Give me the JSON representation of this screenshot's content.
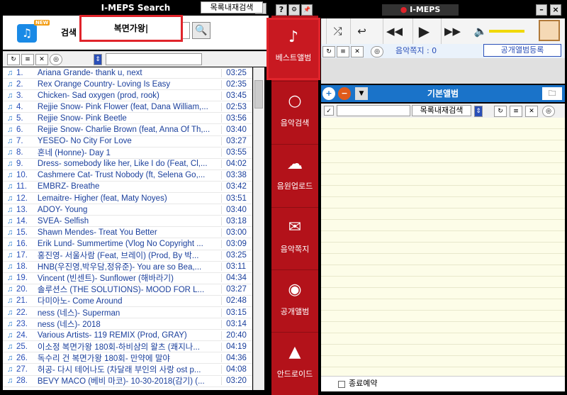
{
  "left_window": {
    "title": "I-MEPS Search",
    "close": "×",
    "logo_new": "NEW",
    "search_label": "검색",
    "search_value": "복면가왕|",
    "list_search_btn": "목록내재검색",
    "songs": [
      {
        "n": "1.",
        "t": "Ariana Grande- thank u, next",
        "d": "03:25"
      },
      {
        "n": "2.",
        "t": "Rex Orange Country- Loving Is Easy",
        "d": "02:35"
      },
      {
        "n": "3.",
        "t": "Chicken- Sad oxygen (prod, rook)",
        "d": "03:45"
      },
      {
        "n": "4.",
        "t": "Rejjie Snow- Pink Flower (feat, Dana William,...",
        "d": "02:53"
      },
      {
        "n": "5.",
        "t": "Rejjie Snow- Pink Beetle",
        "d": "03:56"
      },
      {
        "n": "6.",
        "t": "Rejjie Snow- Charlie Brown (feat, Anna Of Th,...",
        "d": "03:40"
      },
      {
        "n": "7.",
        "t": "YESEO- No City For Love",
        "d": "03:27"
      },
      {
        "n": "8.",
        "t": "혼네 (Honne)- Day 1",
        "d": "03:55"
      },
      {
        "n": "9.",
        "t": "Dress- somebody like her, Like I do (Feat, Cl,...",
        "d": "04:02"
      },
      {
        "n": "10.",
        "t": "Cashmere Cat- Trust Nobody (ft, Selena Go,...",
        "d": "03:38"
      },
      {
        "n": "11.",
        "t": "EMBRZ- Breathe",
        "d": "03:42"
      },
      {
        "n": "12.",
        "t": "Lemaitre- Higher (feat, Maty Noyes)",
        "d": "03:51"
      },
      {
        "n": "13.",
        "t": "ADOY- Young",
        "d": "03:40"
      },
      {
        "n": "14.",
        "t": "SVEA- Selfish",
        "d": "03:18"
      },
      {
        "n": "15.",
        "t": "Shawn Mendes- Treat You Better",
        "d": "03:00"
      },
      {
        "n": "16.",
        "t": "Erik Lund- Summertime (Vlog No Copyright ...",
        "d": "03:09"
      },
      {
        "n": "17.",
        "t": "홍진영- 서울사람 (Feat, 브레이) (Prod, By 박...",
        "d": "03:25"
      },
      {
        "n": "18.",
        "t": "HNB(우진영,박우담,정유준)- You are so Bea,...",
        "d": "03:11"
      },
      {
        "n": "19.",
        "t": "Vincent (빈센트)- Sunflower (해바라기)",
        "d": "04:34"
      },
      {
        "n": "20.",
        "t": "솔루션스 (THE SOLUTIONS)- MOOD FOR L...",
        "d": "03:27"
      },
      {
        "n": "21.",
        "t": "다미아노- Come Around",
        "d": "02:48"
      },
      {
        "n": "22.",
        "t": "ness (네스)- Superman",
        "d": "03:15"
      },
      {
        "n": "23.",
        "t": "ness (네스)- 2018",
        "d": "03:14"
      },
      {
        "n": "24.",
        "t": "Various Artists- 119 REMIX (Prod, GRAY)",
        "d": "20:40"
      },
      {
        "n": "25.",
        "t": "이소정 복면가왕 180회-하비샴의 왈츠 (쾌지나...",
        "d": "04:19"
      },
      {
        "n": "26.",
        "t": "독수리 건 복면가왕 180회- 만약에 말야",
        "d": "04:36"
      },
      {
        "n": "27.",
        "t": "허공- 다시 테어나도 (차달래 부인의 사랑 ost p...",
        "d": "04:08"
      },
      {
        "n": "28.",
        "t": "BEVY MACO (베비 마코)- 10-30-2018(감기) (...",
        "d": "03:20"
      }
    ]
  },
  "nav": {
    "best": "베스트앨범",
    "music_search": "음악검색",
    "upload": "음원업로드",
    "note": "음악쪽지",
    "public_album": "공개앨범",
    "android": "안드로이드"
  },
  "right_window": {
    "title": "I-MEPS",
    "help": "?",
    "settings": "⚙",
    "pin": "📌",
    "minimize": "–",
    "close": "×",
    "note_label": "음악쪽지 : 0",
    "public_album_btn": "공개앨범등록",
    "album_title": "기본앨범",
    "list_search_btn": "목록내재검색",
    "footer_label": "종료예약"
  }
}
